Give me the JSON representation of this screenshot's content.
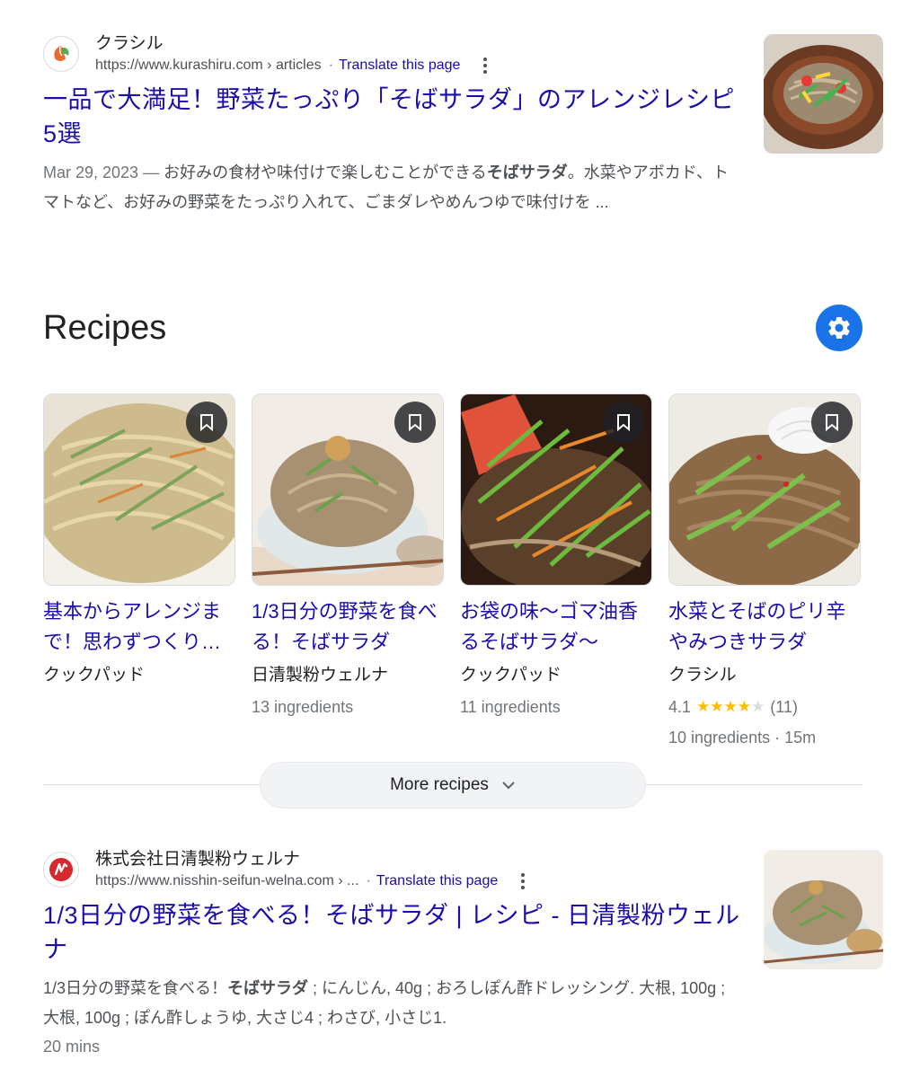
{
  "result1": {
    "site_name": "クラシル",
    "url": "https://www.kurashiru.com › articles",
    "separator": "·",
    "translate": "Translate this page",
    "title": "一品で大満足！野菜たっぷり「そばサラダ」のアレンジレシピ5選",
    "snippet_date": "Mar 29, 2023 —",
    "snippet_text_1": " お好みの食材や味付けで楽しむことができる",
    "snippet_bold": "そばサラダ",
    "snippet_text_2": "。水菜やアボカド、トマトなど、お好みの野菜をたっぷり入れて、ごまダレやめんつゆで味付けを ..."
  },
  "recipes": {
    "heading": "Recipes",
    "cards": [
      {
        "title": "基本からアレンジまで！思わずつくりたくなる",
        "source": "クックパッド",
        "ingredients": ""
      },
      {
        "title": "1/3日分の野菜を食べる！そばサラダ",
        "source": "日清製粉ウェルナ",
        "ingredients": "13 ingredients"
      },
      {
        "title": "お袋の味〜ゴマ油香るそばサラダ〜",
        "source": "クックパッド",
        "ingredients": "11 ingredients"
      },
      {
        "title": "水菜とそばのピリ辛やみつきサラダ",
        "source": "クラシル",
        "rating": "4.1",
        "stars": 4,
        "reviews": "(11)",
        "ingredients": "10 ingredients · 15m"
      }
    ],
    "more_label": "More recipes"
  },
  "result2": {
    "site_name": "株式会社日清製粉ウェルナ",
    "url": "https://www.nisshin-seifun-welna.com › ...",
    "separator": "·",
    "translate": "Translate this page",
    "title": "1/3日分の野菜を食べる！そばサラダ | レシピ - 日清製粉ウェルナ",
    "snippet_text_1": "1/3日分の野菜を食べる！",
    "snippet_bold": "そばサラダ",
    "snippet_text_2": " ; にんじん, 40g ; おろしぽん酢ドレッシング. 大根, 100g ; 大根, 100g ; ぽん酢しょうゆ, 大さじ4 ; わさび, 小さじ1.",
    "time": "20 mins"
  },
  "colors": {
    "link": "#1a0dab",
    "accent": "#1a73e8",
    "star": "#fbbc04",
    "kurashiru_leaf_orange": "#ea6a2b",
    "kurashiru_leaf_green": "#4caf50",
    "nisshin_red": "#d7282f"
  },
  "icons": [
    "kurashiru-logo-icon",
    "kebab-menu-icon",
    "settings-gear-icon",
    "bookmark-icon",
    "chevron-down-icon",
    "nisshin-logo-icon"
  ]
}
